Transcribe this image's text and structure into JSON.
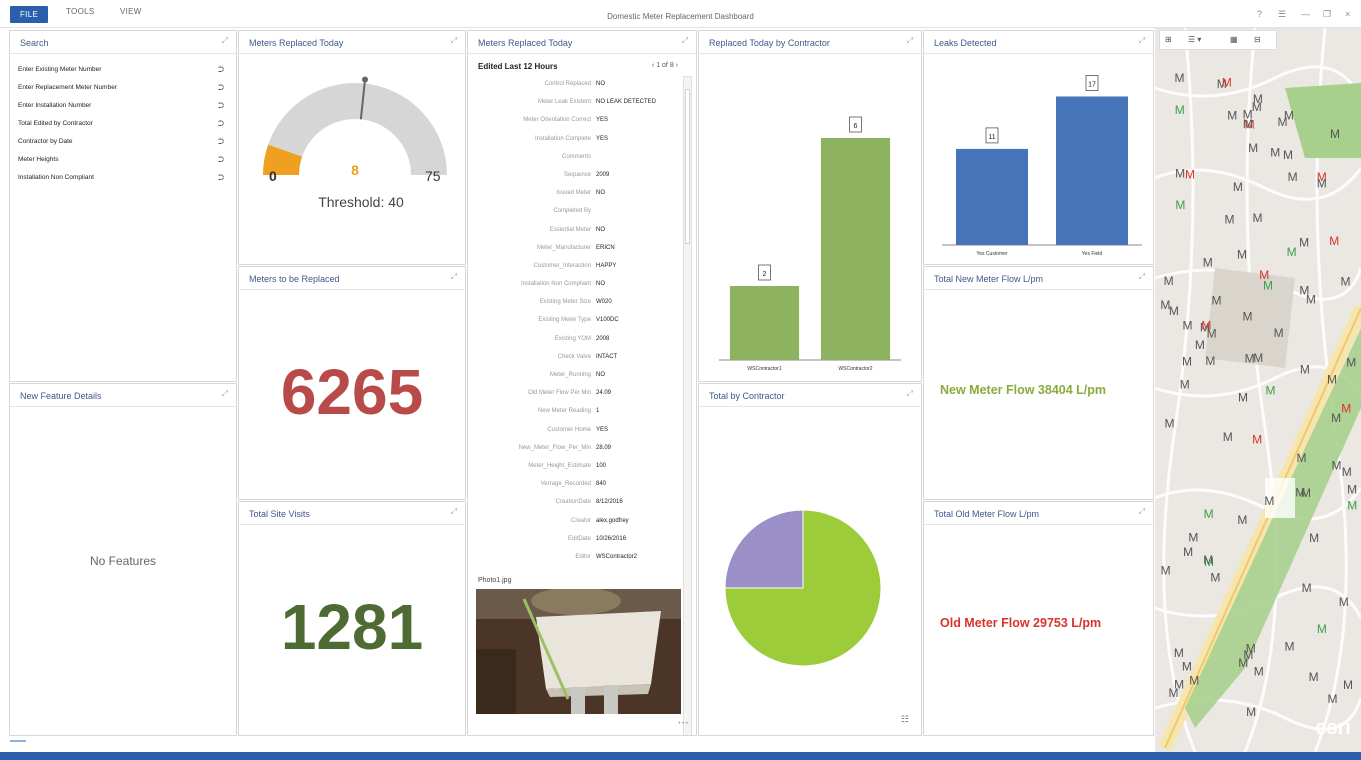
{
  "app": {
    "title": "Domestic Meter Replacement Dashboard",
    "tabs": [
      "FILE",
      "TOOLS",
      "VIEW"
    ],
    "window_controls": [
      "?",
      "☰",
      "—",
      "❐",
      "×"
    ]
  },
  "colors": {
    "accent": "#2b5fad",
    "gauge_fill": "#f0a020",
    "gauge_track": "#d6d6d6",
    "bar_green": "#8db360",
    "bar_blue": "#4674b8",
    "pie_green": "#9ccc3a",
    "pie_purple": "#9a8fc7",
    "red_number": "#b84a4a",
    "green_number": "#4f6b34",
    "new_flow": "#8aab3c",
    "old_flow": "#d9342b"
  },
  "panels": {
    "search": {
      "title": "Search",
      "items": [
        "Enter Existing Meter Number",
        "Enter Replacement Meter Number",
        "Enter Installation Number",
        "Total Edited by Contractor",
        "Contractor by Date",
        "Meter Heights",
        "Installation Non Compliant"
      ]
    },
    "new_feature": {
      "title": "New Feature Details",
      "empty_text": "No Features"
    },
    "gauge": {
      "title": "Meters Replaced Today",
      "value": 8,
      "min": 0,
      "max": 75,
      "threshold": 40,
      "min_label": "0",
      "max_label": "75",
      "value_label": "8",
      "threshold_label": "Threshold: 40"
    },
    "to_replace": {
      "title": "Meters to be Replaced",
      "value": "6265"
    },
    "site_visits": {
      "title": "Total Site Visits",
      "value": "1281"
    },
    "details": {
      "title": "Meters Replaced Today",
      "subtitle": "Edited Last 12 Hours",
      "nav": "‹  1 of 8  ›",
      "fields": [
        {
          "label": "Control Replaced",
          "value": "NO"
        },
        {
          "label": "Meter Leak Existent",
          "value": "NO LEAK DETECTED"
        },
        {
          "label": "Meter Orientation Correct",
          "value": "YES"
        },
        {
          "label": "Installation Complete",
          "value": "YES"
        },
        {
          "label": "Comments",
          "value": ""
        },
        {
          "label": "Sequence",
          "value": "2009"
        },
        {
          "label": "Issued Meter",
          "value": "NO"
        },
        {
          "label": "Completed By",
          "value": ""
        },
        {
          "label": "Essential Meter",
          "value": "NO"
        },
        {
          "label": "Meter_Manufacturer",
          "value": "ERICN"
        },
        {
          "label": "Customer_Interaction",
          "value": "HAPPY"
        },
        {
          "label": "Installation Non Compliant",
          "value": "NO"
        },
        {
          "label": "Existing Meter Size",
          "value": "W020"
        },
        {
          "label": "Existing Meter Type",
          "value": "V100DC"
        },
        {
          "label": "Existing YOM",
          "value": "2008"
        },
        {
          "label": "Check Valve",
          "value": "INTACT"
        },
        {
          "label": "Meter_Running",
          "value": "NO"
        },
        {
          "label": "Old Meter Flow Per Min",
          "value": "24.09"
        },
        {
          "label": "New Meter Reading",
          "value": "1"
        },
        {
          "label": "Customer Home",
          "value": "YES"
        },
        {
          "label": "New_Meter_Flow_Per_Min",
          "value": "28.09"
        },
        {
          "label": "Meter_Height_Estimate",
          "value": "100"
        },
        {
          "label": "Verrage_Recorded",
          "value": "840"
        },
        {
          "label": "CreationDate",
          "value": "8/12/2016"
        },
        {
          "label": "Creator",
          "value": "alex.godfrey"
        },
        {
          "label": "EditDate",
          "value": "10/26/2016"
        },
        {
          "label": "Editor",
          "value": "WSContractor2"
        }
      ],
      "photo_label": "Photo1.jpg",
      "more": "• • •"
    },
    "contractor_chart": {
      "title": "Replaced Today by Contractor"
    },
    "leaks": {
      "title": "Leaks Detected"
    },
    "pie": {
      "title": "Total by Contractor"
    },
    "new_flow": {
      "title": "Total New Meter Flow L/pm",
      "text": "New Meter Flow  38404 L/pm"
    },
    "old_flow": {
      "title": "Total Old Meter Flow L/pm",
      "text": "Old Meter Flow  29753 L/pm"
    },
    "map": {
      "toolbar": [
        "⊞",
        "☰ ▾",
        "▦",
        "⊟"
      ],
      "marker_letter": "M",
      "brand": "esri"
    }
  },
  "chart_data": [
    {
      "type": "bar",
      "title": "Replaced Today by Contractor",
      "categories": [
        "WSContractor1",
        "WSContractor2"
      ],
      "values": [
        2,
        6
      ],
      "ylim": [
        0,
        7
      ]
    },
    {
      "type": "bar",
      "title": "Leaks Detected",
      "categories": [
        "Yes Customer",
        "Yes Field"
      ],
      "values": [
        11,
        17
      ],
      "ylim": [
        0,
        19
      ]
    },
    {
      "type": "pie",
      "title": "Total by Contractor",
      "categories": [
        "WSContractor1",
        "WSContractor2"
      ],
      "values": [
        25,
        75
      ]
    }
  ]
}
